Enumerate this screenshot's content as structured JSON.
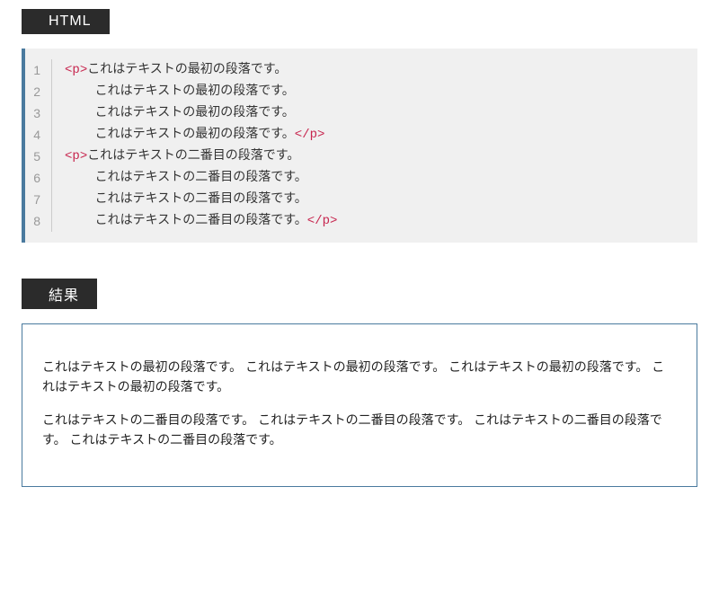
{
  "headers": {
    "html": "HTML",
    "result": "結果"
  },
  "code": {
    "line_numbers": [
      "1",
      "2",
      "3",
      "4",
      "5",
      "6",
      "7",
      "8"
    ],
    "lines": [
      {
        "type": "open",
        "tag": "p",
        "text": "これはテキストの最初の段落です。",
        "indent": ""
      },
      {
        "type": "plain",
        "text": "これはテキストの最初の段落です。",
        "indent": "    "
      },
      {
        "type": "plain",
        "text": "これはテキストの最初の段落です。",
        "indent": "    "
      },
      {
        "type": "close",
        "tag": "p",
        "text": "これはテキストの最初の段落です。",
        "indent": "    "
      },
      {
        "type": "open",
        "tag": "p",
        "text": "これはテキストの二番目の段落です。",
        "indent": ""
      },
      {
        "type": "plain",
        "text": "これはテキストの二番目の段落です。",
        "indent": "    "
      },
      {
        "type": "plain",
        "text": "これはテキストの二番目の段落です。",
        "indent": "    "
      },
      {
        "type": "close",
        "tag": "p",
        "text": "これはテキストの二番目の段落です。",
        "indent": "    "
      }
    ]
  },
  "result": {
    "paragraphs": [
      "これはテキストの最初の段落です。 これはテキストの最初の段落です。 これはテキストの最初の段落です。 これはテキストの最初の段落です。",
      "これはテキストの二番目の段落です。 これはテキストの二番目の段落です。 これはテキストの二番目の段落です。 これはテキストの二番目の段落です。"
    ]
  }
}
